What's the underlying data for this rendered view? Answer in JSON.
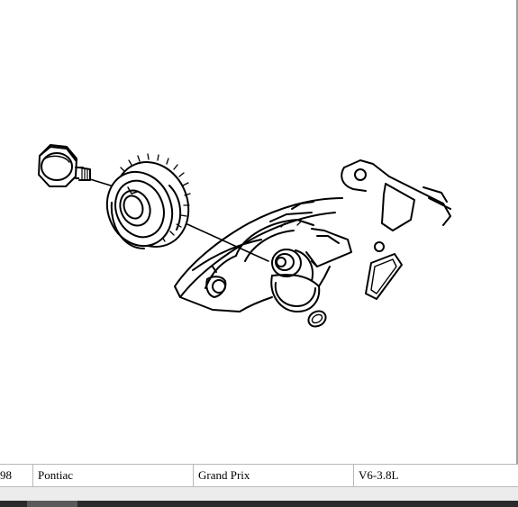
{
  "vehicle_bar": {
    "year": "98",
    "make": "Pontiac",
    "model": "Grand Prix",
    "engine": "V6-3.8L"
  },
  "diagram": {
    "subject": "crankshaft sprocket, bolt and front cover exploded view",
    "line_color": "#000000",
    "background": "#ffffff"
  }
}
